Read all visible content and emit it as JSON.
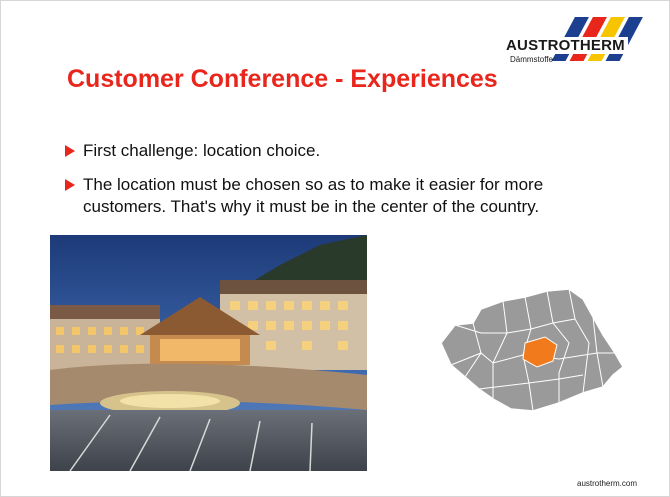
{
  "logo": {
    "name": "AUSTROTHERM",
    "tagline": "Dämmstoffe",
    "stripe_colors": [
      "#1d3f8f",
      "#e8261c",
      "#f6c500"
    ]
  },
  "slide": {
    "title": "Customer Conference - Experiences",
    "bullets": [
      {
        "text": "First challenge: location choice."
      },
      {
        "text": "The location must be chosen so as to make it easier for more customers. That's why it must be in the center of the country."
      }
    ],
    "bullet_icon": "triangle-right-icon",
    "footer": "austrotherm.com"
  },
  "colors": {
    "title": "#e8261c",
    "bullet_marker": "#e8261c",
    "map_region": "#999999",
    "map_highlight": "#f07a1c"
  },
  "images": {
    "photo": "hotel-resort-photo",
    "map": "romania-regions-map"
  }
}
